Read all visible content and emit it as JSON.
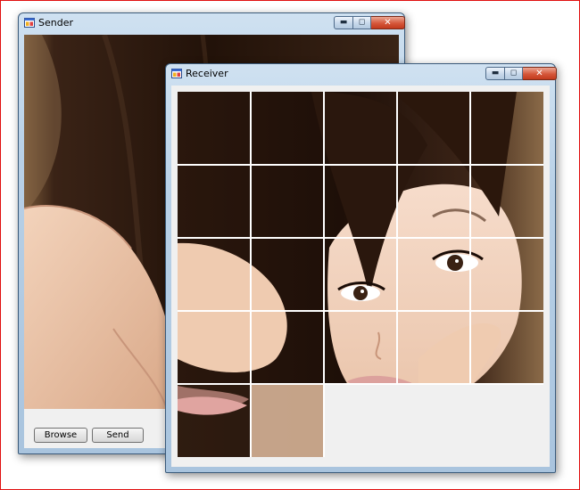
{
  "sender": {
    "title": "Sender",
    "browse_label": "Browse",
    "send_label": "Send",
    "icon": "app-window-icon"
  },
  "receiver": {
    "title": "Receiver",
    "icon": "app-window-icon",
    "grid": {
      "rows": 5,
      "cols": 5,
      "filled_tiles": 22
    }
  },
  "window_controls": {
    "minimize": "minimize-icon",
    "maximize": "maximize-icon",
    "close": "close-icon"
  },
  "colors": {
    "frame_border": "#e01010",
    "title_gradient": "#b9d1e7",
    "close_button": "#c23a1d",
    "client_bg": "#f0f0f0"
  }
}
